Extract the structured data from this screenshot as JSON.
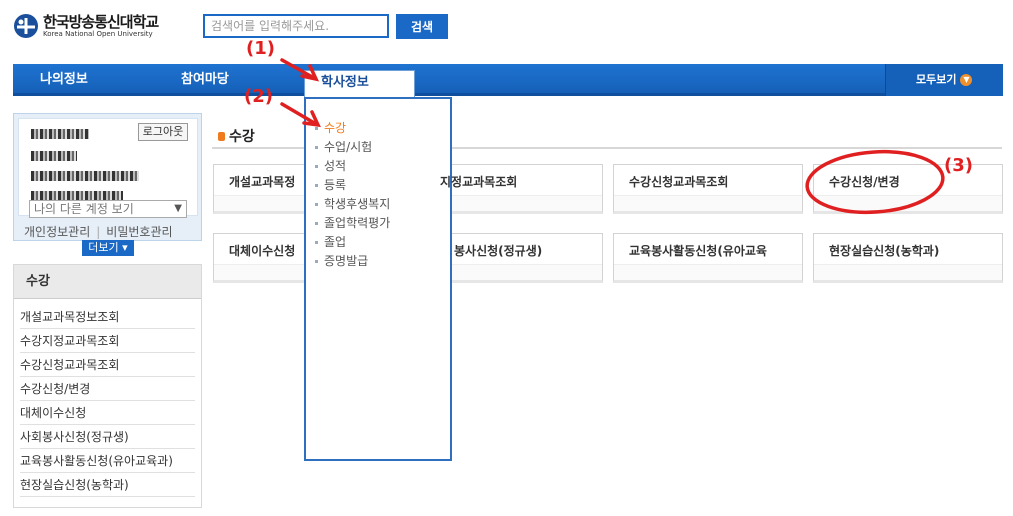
{
  "header": {
    "logo_ko": "한국방송통신대학교",
    "logo_en": "Korea National Open University",
    "search_placeholder": "검색어를 입력해주세요.",
    "search_button": "검색"
  },
  "nav": {
    "items": [
      "나의정보",
      "참여마당"
    ],
    "active": "학사정보",
    "view_all": "모두보기"
  },
  "dropdown": {
    "items": [
      "수강",
      "수업/시험",
      "성적",
      "등록",
      "학생후생복지",
      "졸업학력평가",
      "졸업",
      "증명발급"
    ],
    "selected": "수강"
  },
  "user_panel": {
    "logout": "로그아웃",
    "account_select": "나의 다른 계정 보기",
    "link_profile": "개인정보관리",
    "link_password": "비밀번호관리",
    "more": "더보기"
  },
  "side_menu": {
    "title": "수강",
    "items": [
      "개설교과목정보조회",
      "수강지정교과목조회",
      "수강신청교과목조회",
      "수강신청/변경",
      "대체이수신청",
      "사회봉사신청(정규생)",
      "교육봉사활동신청(유아교육과)",
      "현장실습신청(농학과)"
    ]
  },
  "main": {
    "section_title": "수강",
    "cards": [
      "개설교과목정",
      "지정교과목조회",
      "수강신청교과목조회",
      "수강신청/변경",
      "대체이수신청",
      "봉사신청(정규생)",
      "교육봉사활동신청(유아교육",
      "현장실습신청(농학과)"
    ]
  },
  "annotations": {
    "step1": "(1)",
    "step2": "(2)",
    "step3": "(3)"
  },
  "colors": {
    "brand_blue": "#1b69c7",
    "accent_orange": "#f07b1c",
    "annotation_red": "#e02020"
  }
}
